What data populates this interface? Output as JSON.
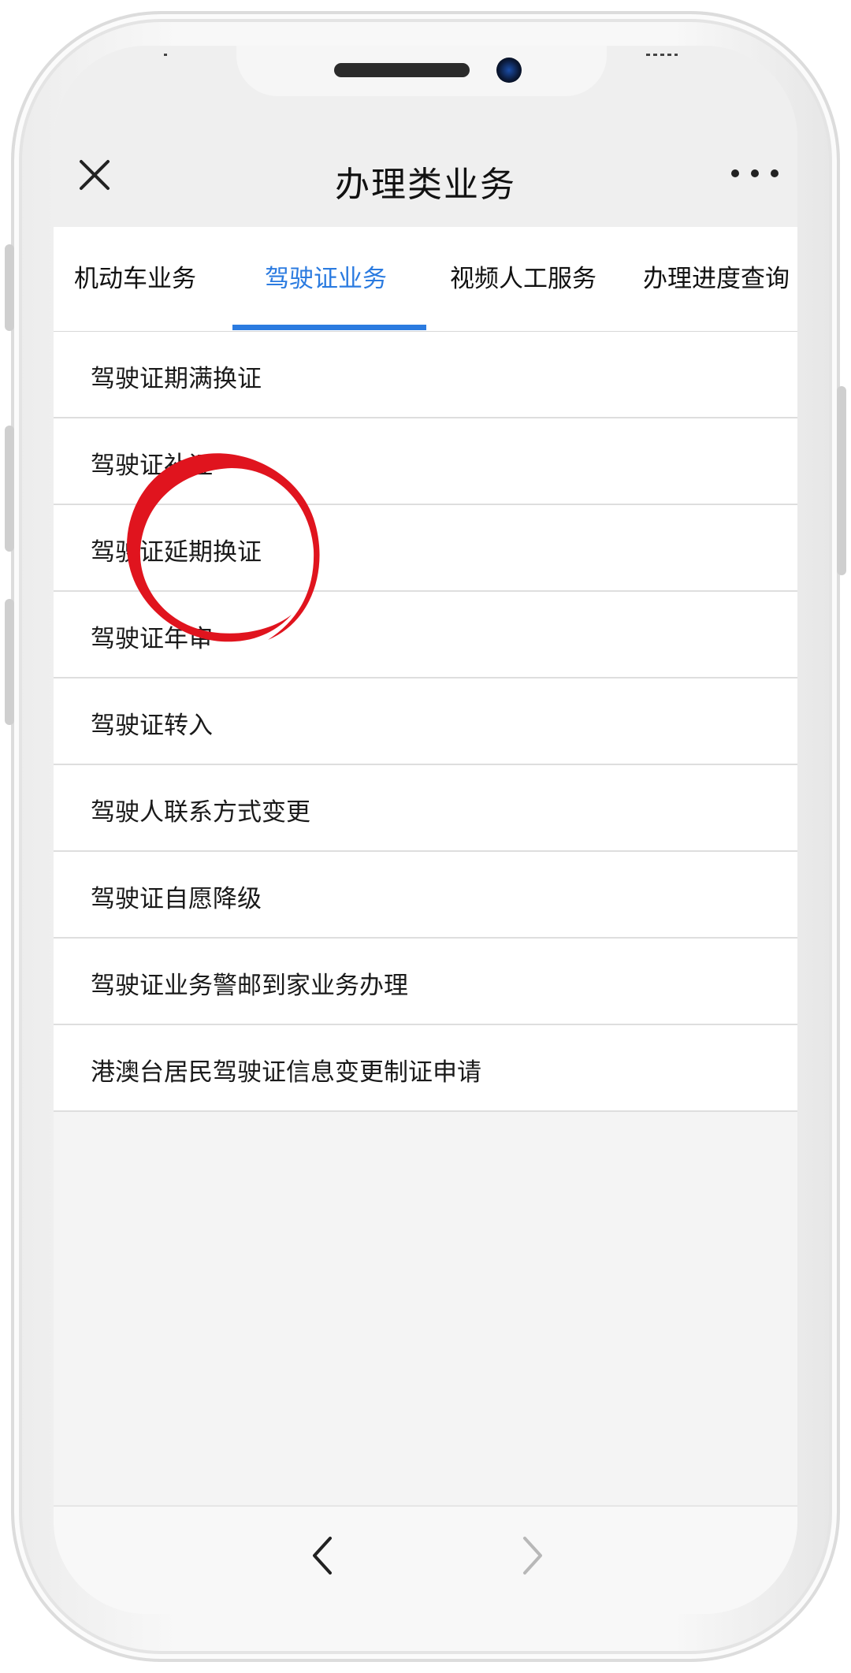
{
  "header": {
    "title": "办理类业务",
    "close_icon": "close-icon",
    "more_icon": "more-icon"
  },
  "tabs": [
    {
      "label": "机动车业务",
      "active": false
    },
    {
      "label": "驾驶证业务",
      "active": true
    },
    {
      "label": "视频人工服务",
      "active": false
    },
    {
      "label": "办理进度查询",
      "active": false
    }
  ],
  "list": {
    "items": [
      "驾驶证期满换证",
      "驾驶证补证",
      "驾驶证延期换证",
      "驾驶证年审",
      "驾驶证转入",
      "驾驶人联系方式变更",
      "驾驶证自愿降级",
      "驾驶证业务警邮到家业务办理",
      "港澳台居民驾驶证信息变更制证申请"
    ]
  },
  "bottom_nav": {
    "back_icon": "chevron-left-icon",
    "forward_icon": "chevron-right-icon"
  },
  "colors": {
    "accent": "#2b7be0",
    "annotation": "#e0141e"
  }
}
